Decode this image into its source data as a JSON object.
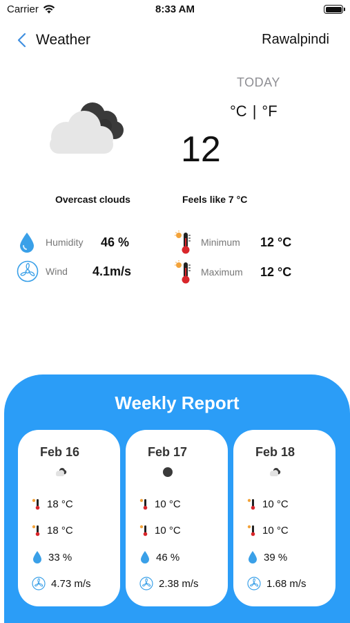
{
  "status_bar": {
    "carrier": "Carrier",
    "time": "8:33 AM"
  },
  "nav": {
    "title": "Weather",
    "city": "Rawalpindi"
  },
  "current": {
    "day_label": "TODAY",
    "unit_c": "°C",
    "unit_sep": "|",
    "unit_f": "°F",
    "temperature": "12",
    "description": "Overcast clouds",
    "feels_like": "Feels like 7 °C",
    "humidity_label": "Humidity",
    "humidity_value": "46 %",
    "wind_label": "Wind",
    "wind_value": "4.1m/s",
    "min_label": "Minimum",
    "min_value": "12 °C",
    "max_label": "Maximum",
    "max_value": "12 °C"
  },
  "weekly": {
    "title": "Weekly Report",
    "days": [
      {
        "date": "Feb 16",
        "icon": "broken-clouds-icon",
        "min": "18 °C",
        "max": "18 °C",
        "humidity": "33 %",
        "wind": "4.73 m/s"
      },
      {
        "date": "Feb 17",
        "icon": "overcast-clouds-icon",
        "min": "10 °C",
        "max": "10 °C",
        "humidity": "46 %",
        "wind": "2.38 m/s"
      },
      {
        "date": "Feb 18",
        "icon": "broken-clouds-icon",
        "min": "10 °C",
        "max": "10 °C",
        "humidity": "39 %",
        "wind": "1.68 m/s"
      }
    ]
  },
  "colors": {
    "accent": "#2b9df7",
    "water": "#3aa0e8",
    "thermo_red": "#d9262b",
    "sun_orange": "#f3a33a"
  }
}
